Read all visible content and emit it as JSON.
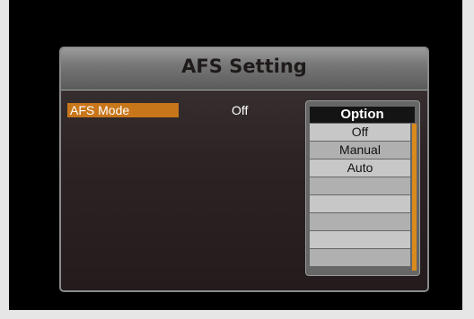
{
  "dialog": {
    "title": "AFS Setting",
    "row_label": "AFS Mode",
    "row_value": "Off"
  },
  "options": {
    "header": "Option",
    "items": [
      "Off",
      "Manual",
      "Auto",
      "",
      "",
      "",
      "",
      ""
    ]
  },
  "colors": {
    "highlight": "#c8761a",
    "scrollbar": "#d98a1c"
  }
}
